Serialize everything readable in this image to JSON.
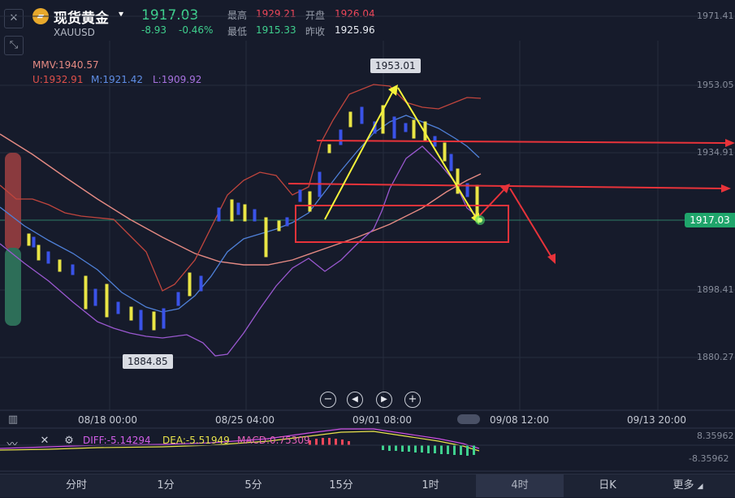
{
  "header": {
    "title": "现货黄金",
    "symbol": "XAUUSD",
    "price": "1917.03",
    "change": "-8.93",
    "change_pct": "-0.46%",
    "high_label": "最高",
    "high": "1929.21",
    "open_label": "开盘",
    "open": "1926.04",
    "low_label": "最低",
    "low": "1915.33",
    "prev_label": "昨收",
    "prev": "1925.96"
  },
  "indicators": {
    "mmv": "MMV:1940.57",
    "upper": "U:1932.91",
    "middle": "M:1921.42",
    "lower": "L:1909.92"
  },
  "axis": {
    "price_ticks": [
      "1971.41",
      "1953.05",
      "1934.91",
      "1898.41",
      "1880.27"
    ],
    "current_price_tag": "1917.03",
    "date_ticks": [
      "08/18 00:00",
      "08/25 04:00",
      "09/01 08:00",
      "09/08 12:00",
      "09/13 20:00"
    ]
  },
  "annotations": {
    "peak": "1953.01",
    "trough": "1884.85"
  },
  "macd": {
    "diff": "DIFF:-5.14294",
    "dea": "DEA:-5.51949",
    "macd": "MACD:0.75309",
    "top_value": "8.35962",
    "bottom_value": "-8.35962"
  },
  "tabs": [
    "分时",
    "1分",
    "5分",
    "15分",
    "1时",
    "4时",
    "日K",
    "更多"
  ],
  "active_tab": "4时",
  "colors": {
    "up": "#f0475a",
    "down": "#3fd08e",
    "arrow_red": "#e8333a",
    "arrow_yellow": "#f5f33a"
  }
}
